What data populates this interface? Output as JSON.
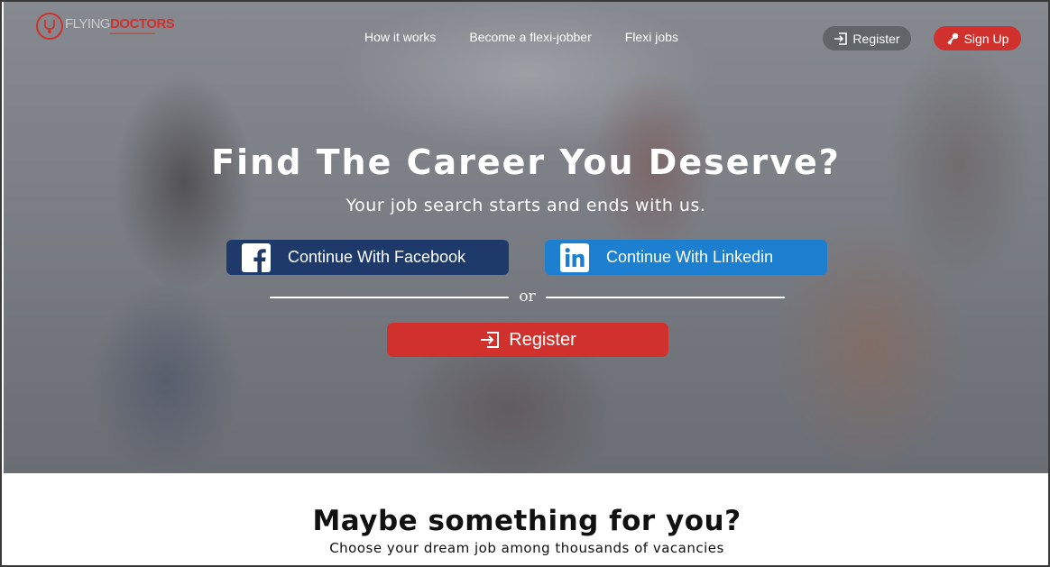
{
  "logo": {
    "name_part1": "FLYING",
    "name_part2": "DOCTORS"
  },
  "nav": {
    "items": [
      {
        "label": "How it works"
      },
      {
        "label": "Become a flexi-jobber"
      },
      {
        "label": "Flexi jobs"
      }
    ]
  },
  "header": {
    "register_label": "Register",
    "signup_label": "Sign Up"
  },
  "hero": {
    "title": "Find The Career You Deserve?",
    "subtitle": "Your job search starts and ends with us.",
    "facebook_label": "Continue With Facebook",
    "linkedin_label": "Continue With Linkedin",
    "or_label": "or",
    "register_label": "Register"
  },
  "section": {
    "title": "Maybe something for you?",
    "subtitle": "Choose your dream job among thousands of vacancies"
  },
  "colors": {
    "accent_red": "#d0312d",
    "facebook_blue": "#1d3a6b",
    "linkedin_blue": "#1d7fd0"
  },
  "icons": {
    "register": "sign-in-icon",
    "signup": "key-icon",
    "facebook": "facebook-icon",
    "linkedin": "linkedin-icon"
  }
}
